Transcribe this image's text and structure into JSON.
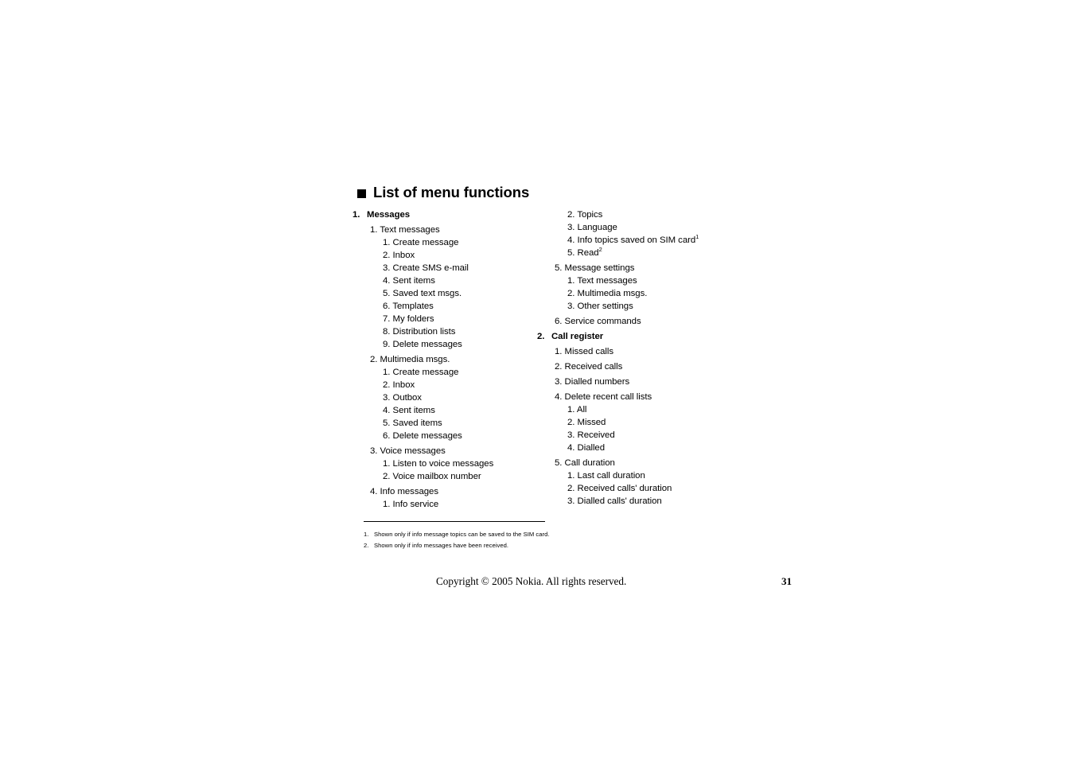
{
  "page": {
    "heading": "List of menu functions",
    "heading_bullet_icon": "filled-square-bullet-icon",
    "page_number": "31",
    "copyright": "Copyright © 2005 Nokia. All rights reserved."
  },
  "columns": {
    "left": [
      {
        "level": 1,
        "num": "1.",
        "label": "Messages",
        "gap": false
      },
      {
        "level": 2,
        "num": "1.",
        "label": "Text messages",
        "gap": true
      },
      {
        "level": 3,
        "num": "1.",
        "label": "Create message",
        "gap": false
      },
      {
        "level": 3,
        "num": "2.",
        "label": "Inbox",
        "gap": false
      },
      {
        "level": 3,
        "num": "3.",
        "label": "Create SMS e-mail",
        "gap": false
      },
      {
        "level": 3,
        "num": "4.",
        "label": "Sent items",
        "gap": false
      },
      {
        "level": 3,
        "num": "5.",
        "label": "Saved text msgs.",
        "gap": false
      },
      {
        "level": 3,
        "num": "6.",
        "label": "Templates",
        "gap": false
      },
      {
        "level": 3,
        "num": "7.",
        "label": "My folders",
        "gap": false
      },
      {
        "level": 3,
        "num": "8.",
        "label": "Distribution lists",
        "gap": false
      },
      {
        "level": 3,
        "num": "9.",
        "label": "Delete messages",
        "gap": false
      },
      {
        "level": 2,
        "num": "2.",
        "label": "Multimedia msgs.",
        "gap": true
      },
      {
        "level": 3,
        "num": "1.",
        "label": "Create message",
        "gap": false
      },
      {
        "level": 3,
        "num": "2.",
        "label": "Inbox",
        "gap": false
      },
      {
        "level": 3,
        "num": "3.",
        "label": "Outbox",
        "gap": false
      },
      {
        "level": 3,
        "num": "4.",
        "label": "Sent items",
        "gap": false
      },
      {
        "level": 3,
        "num": "5.",
        "label": "Saved items",
        "gap": false
      },
      {
        "level": 3,
        "num": "6.",
        "label": "Delete messages",
        "gap": false
      },
      {
        "level": 2,
        "num": "3.",
        "label": "Voice messages",
        "gap": true
      },
      {
        "level": 3,
        "num": "1.",
        "label": "Listen to voice messages",
        "gap": false
      },
      {
        "level": 3,
        "num": "2.",
        "label": "Voice mailbox number",
        "gap": false
      },
      {
        "level": 2,
        "num": "4.",
        "label": "Info messages",
        "gap": true
      },
      {
        "level": 3,
        "num": "1.",
        "label": "Info service",
        "gap": false
      }
    ],
    "right": [
      {
        "level": 3,
        "num": "2.",
        "label": "Topics",
        "gap": false
      },
      {
        "level": 3,
        "num": "3.",
        "label": "Language",
        "gap": false
      },
      {
        "level": 3,
        "num": "4.",
        "label": "Info topics saved on SIM card",
        "sup": "1",
        "gap": false
      },
      {
        "level": 3,
        "num": "5.",
        "label": "Read",
        "sup": "2",
        "gap": false
      },
      {
        "level": 2,
        "num": "5.",
        "label": "Message settings",
        "gap": true
      },
      {
        "level": 3,
        "num": "1.",
        "label": "Text messages",
        "gap": false
      },
      {
        "level": 3,
        "num": "2.",
        "label": "Multimedia msgs.",
        "gap": false
      },
      {
        "level": 3,
        "num": "3.",
        "label": "Other settings",
        "gap": false
      },
      {
        "level": 2,
        "num": "6.",
        "label": "Service commands",
        "gap": true
      },
      {
        "level": 1,
        "num": "2.",
        "label": "Call register",
        "gap": true
      },
      {
        "level": 2,
        "num": "1.",
        "label": "Missed calls",
        "gap": true
      },
      {
        "level": 2,
        "num": "2.",
        "label": "Received calls",
        "gap": true
      },
      {
        "level": 2,
        "num": "3.",
        "label": "Dialled numbers",
        "gap": true
      },
      {
        "level": 2,
        "num": "4.",
        "label": "Delete recent call lists",
        "gap": true
      },
      {
        "level": 3,
        "num": "1.",
        "label": "All",
        "gap": false
      },
      {
        "level": 3,
        "num": "2.",
        "label": "Missed",
        "gap": false
      },
      {
        "level": 3,
        "num": "3.",
        "label": "Received",
        "gap": false
      },
      {
        "level": 3,
        "num": "4.",
        "label": "Dialled",
        "gap": false
      },
      {
        "level": 2,
        "num": "5.",
        "label": "Call duration",
        "gap": true
      },
      {
        "level": 3,
        "num": "1.",
        "label": "Last call duration",
        "gap": false
      },
      {
        "level": 3,
        "num": "2.",
        "label": "Received calls' duration",
        "gap": false
      },
      {
        "level": 3,
        "num": "3.",
        "label": "Dialled calls' duration",
        "gap": false
      }
    ]
  },
  "footnotes": [
    {
      "num": "1.",
      "text": "Shown only if info message topics can be saved to the SIM card."
    },
    {
      "num": "2.",
      "text": "Shown only if info messages have been received."
    }
  ]
}
